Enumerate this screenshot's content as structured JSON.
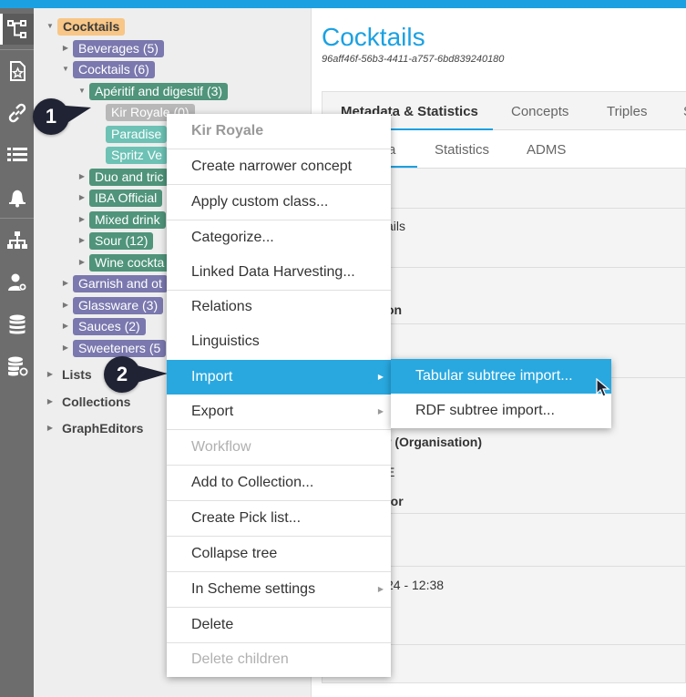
{
  "app": {
    "accent": "#1ba1e2"
  },
  "rail": {
    "icons": [
      "tree-icon",
      "starred-page-icon",
      "link-icon",
      "list-icon",
      "bell-icon",
      "hierarchy-icon",
      "user-gear-icon",
      "database-icon",
      "database-settings-icon"
    ]
  },
  "tree": {
    "root": "Cocktails",
    "beverages": "Beverages (5)",
    "cocktails": "Cocktails (6)",
    "aperitif": "Apéritif and digestif (3)",
    "kir_royale": "Kir Royale (0)",
    "paradise": "Paradise",
    "spritz": "Spritz Ve",
    "duo": "Duo and tric",
    "iba": "IBA Official",
    "mixed": "Mixed drink",
    "sour": "Sour (12)",
    "wine": "Wine cockta",
    "garnish": "Garnish and ot",
    "glassware": "Glassware (3)",
    "sauces": "Sauces (2)",
    "sweeteners": "Sweeteners (5",
    "lists": "Lists",
    "collections": "Collections",
    "grapheditors": "GraphEditors"
  },
  "main": {
    "title": "Cocktails",
    "uuid": "96aff46f-56b3-4411-a757-6bd839240180",
    "tabs": [
      "Metadata & Statistics",
      "Concepts",
      "Triples",
      "S"
    ],
    "subtabs": [
      "a",
      "Statistics",
      "ADMS"
    ],
    "fragments": {
      "f1": "ails",
      "f2": "on",
      "f3": "r (Organisation)",
      "f4": "E",
      "f5": "tor",
      "f6": "24 - 12:38"
    }
  },
  "callouts": {
    "one": "1",
    "two": "2"
  },
  "context_menu": {
    "header": "Kir Royale",
    "items": [
      "Create narrower concept",
      "Apply custom class...",
      "Categorize...",
      "Linked Data Harvesting...",
      "Relations",
      "Linguistics",
      "Import",
      "Export",
      "Workflow",
      "Add to Collection...",
      "Create Pick list...",
      "Collapse tree",
      "In Scheme settings",
      "Delete",
      "Delete children"
    ],
    "submenu_arrow": "▶"
  },
  "import_submenu": {
    "items": [
      "Tabular subtree import...",
      "RDF subtree import..."
    ]
  },
  "tree_arrows": {
    "expanded": "▼",
    "collapsed": "▶"
  }
}
